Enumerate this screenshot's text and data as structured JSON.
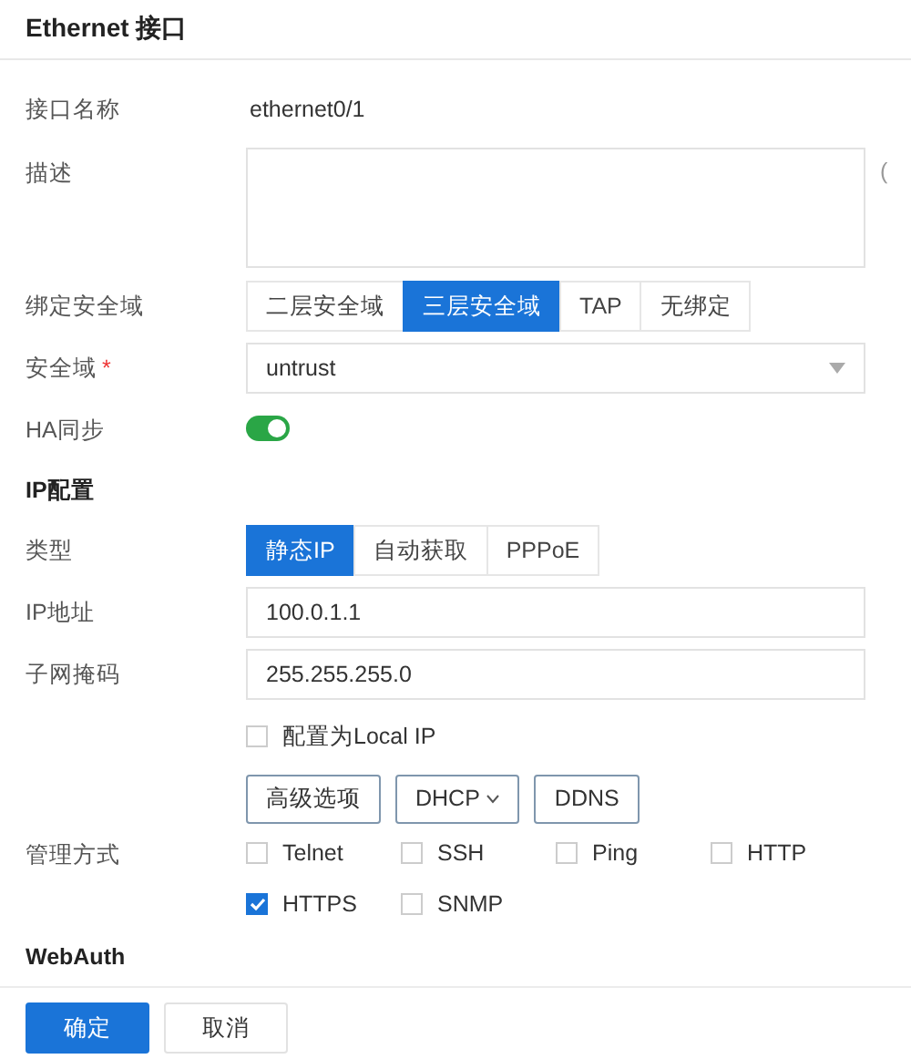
{
  "window": {
    "title": "Ethernet 接口"
  },
  "fields": [
    {
      "kind": "text",
      "label": "接口名称",
      "value": "ethernet0/1"
    },
    {
      "kind": "textarea",
      "label": "描述",
      "side_text": "("
    },
    {
      "kind": "segmented",
      "label": "绑定安全域",
      "options": [
        {
          "label": "二层安全域",
          "selected": false
        },
        {
          "label": "三层安全域",
          "selected": true
        },
        {
          "label": "TAP",
          "selected": false
        },
        {
          "label": "无绑定",
          "selected": false
        }
      ]
    },
    {
      "kind": "select",
      "label": "安全域",
      "required_mark": "*",
      "value": "untrust"
    },
    {
      "kind": "switch",
      "label": "HA同步",
      "on": true
    },
    {
      "kind": "section",
      "label": "IP配置"
    },
    {
      "kind": "segmented",
      "label": "类型",
      "options": [
        {
          "label": "静态IP",
          "selected": true
        },
        {
          "label": "自动获取",
          "selected": false
        },
        {
          "label": "PPPoE",
          "selected": false
        }
      ]
    },
    {
      "kind": "input",
      "label": "IP地址",
      "value": "100.0.1.1"
    },
    {
      "kind": "input",
      "label": "子网掩码",
      "value": "255.255.255.0"
    },
    {
      "kind": "checkbox",
      "label": "配置为Local IP",
      "checked": false
    },
    {
      "kind": "buttons",
      "buttons": [
        {
          "label": "高级选项",
          "dropdown": false
        },
        {
          "label": "DHCP",
          "dropdown": true
        },
        {
          "label": "DDNS",
          "dropdown": false
        }
      ]
    },
    {
      "kind": "checkgroup",
      "label": "管理方式",
      "options": [
        {
          "label": "Telnet",
          "checked": false
        },
        {
          "label": "SSH",
          "checked": false
        },
        {
          "label": "Ping",
          "checked": false
        },
        {
          "label": "HTTP",
          "checked": false
        },
        {
          "label": "HTTPS",
          "checked": true
        },
        {
          "label": "SNMP",
          "checked": false
        }
      ]
    },
    {
      "kind": "section",
      "label": "WebAuth"
    }
  ],
  "footer": {
    "buttons": [
      {
        "label": "确定",
        "primary": true
      },
      {
        "label": "取消",
        "primary": false
      }
    ]
  }
}
